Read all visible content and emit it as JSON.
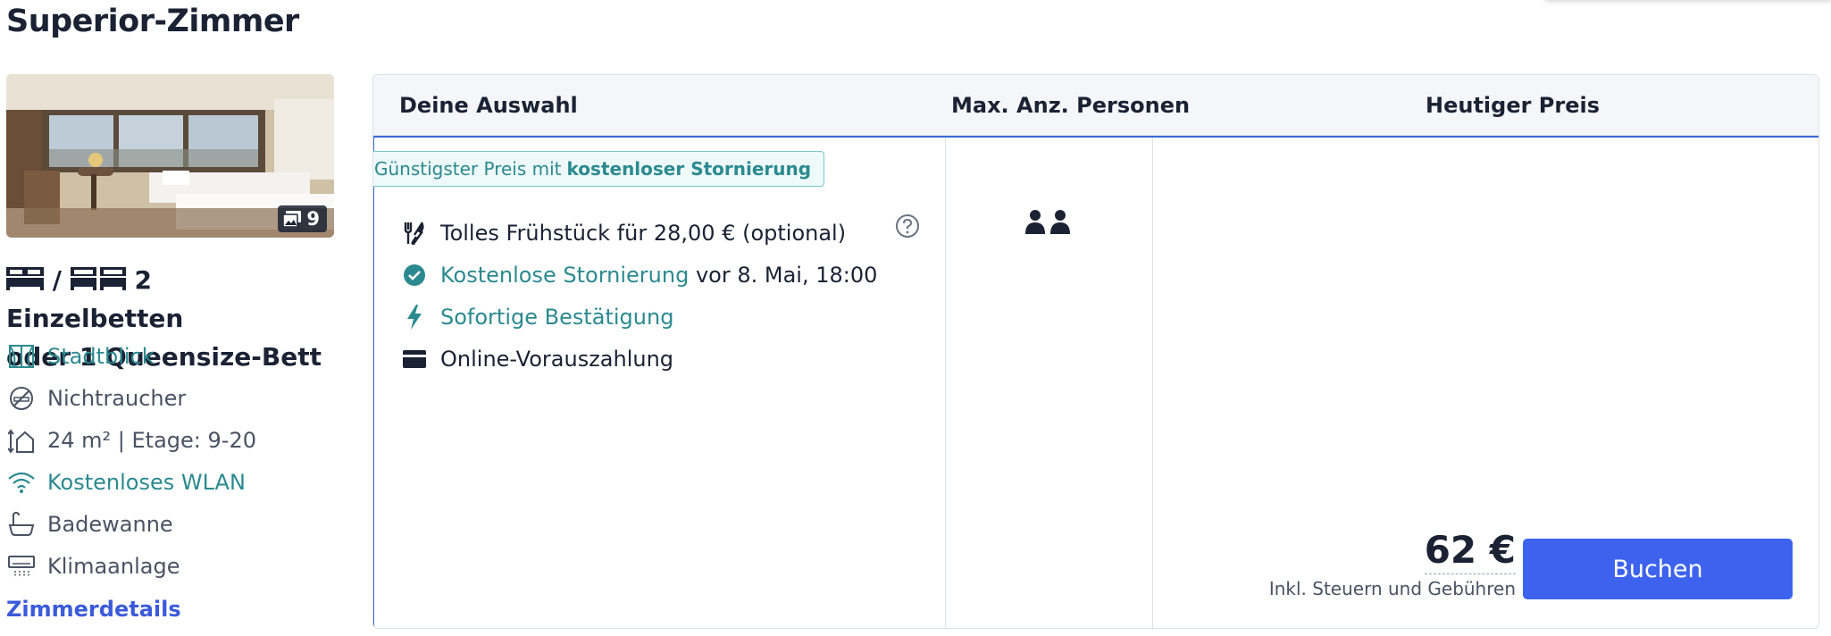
{
  "room": {
    "title": "Superior-Zimmer",
    "photo_count": "9",
    "bed_separator": "/",
    "bed_text_line1": "2 Einzelbetten",
    "bed_text_line2": "oder 1 Queensize-Bett",
    "amenities": [
      {
        "label": "Stadtblick",
        "icon": "window-view-icon",
        "link": true
      },
      {
        "label": "Nichtraucher",
        "icon": "no-smoking-icon",
        "link": false
      },
      {
        "label": "24 m² | Etage: 9-20",
        "icon": "room-size-icon",
        "link": false
      },
      {
        "label": "Kostenloses WLAN",
        "icon": "wifi-icon",
        "link": true
      },
      {
        "label": "Badewanne",
        "icon": "bathtub-icon",
        "link": false
      },
      {
        "label": "Klimaanlage",
        "icon": "air-conditioning-icon",
        "link": false
      }
    ],
    "details_link": "Zimmerdetails"
  },
  "table": {
    "headers": {
      "selection": "Deine Auswahl",
      "persons": "Max. Anz. Personen",
      "price": "Heutiger Preis"
    },
    "badge": {
      "text": "Günstigster Preis mit",
      "bold": "kostenloser Stornierung"
    },
    "features": {
      "breakfast": "Tolles Frühstück für 28,00 € (optional)",
      "cancellation_link": "Kostenlose Stornierung",
      "cancellation_rest": "vor 8. Mai, 18:00",
      "confirmation": "Sofortige Bestätigung",
      "payment": "Online-Vorauszahlung"
    },
    "max_persons": 2,
    "price": "62 €",
    "price_note": "Inkl. Steuern und Gebühren",
    "book_label": "Buchen"
  },
  "colors": {
    "accent": "#3d63ee",
    "teal": "#2b8a8f",
    "text": "#1a2233",
    "selected_border": "#3b6ad8"
  }
}
